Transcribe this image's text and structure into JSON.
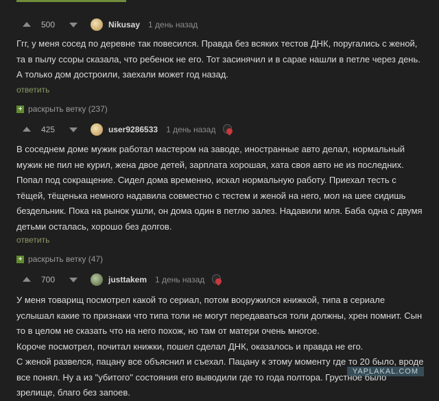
{
  "comments": [
    {
      "score": "500",
      "username": "Nikusay",
      "time": "1 день назад",
      "text": "Ггг, у меня сосед по деревне так повесился. Правда без всяких тестов ДНК, поругались с женой, та в пылу ссоры сказала, что ребенок не его. Тот засинячил и в сарае нашли в петле через день. А только дом достроили, заехали может год назад.",
      "reply": "ответить",
      "expand": "раскрыть ветку (237)"
    },
    {
      "score": "425",
      "username": "user9286533",
      "time": "1 день назад",
      "text": "В соседнем доме мужик работал мастером на заводе, иностранные авто делал, нормальный мужик не пил не курил, жена двое детей, зарплата хорошая, хата своя авто не из последних. Попал под сокращение. Сидел дома временно, искал нормальную работу. Приехал тесть с тёщей, тёщенька немного надавила совместно с тестем и женой на него, мол на шее сидишь бездельник. Пока на рынок ушли, он дома один в петлю залез. Надавили мля. Баба одна с двумя детьми осталась, хорошо без долгов.",
      "reply": "ответить",
      "expand": "раскрыть ветку (47)"
    },
    {
      "score": "700",
      "username": "justtakem",
      "time": "1 день назад",
      "paragraphs": [
        "У меня товарищ посмотрел какой то сериал, потом вооружился книжкой, типа в сериале услышал какие то признаки что типа толи не могут передаваться толи должны, хрен помнит. Сын то в целом не сказать что на него похож, но там от матери очень многое.",
        "Короче посмотрел, почитал книжки, пошел сделал ДНК, оказалось и правда не его.",
        "С женой развелся, пацану все объяснил и съехал. Пацану к этому моменту где то 20 было, вроде все понял. Ну а из \"убитого\" состояния его выводили где то года полтора. Грустное было зрелище, благо без запоев."
      ]
    }
  ],
  "watermark": "YAPLAKAL.COM"
}
